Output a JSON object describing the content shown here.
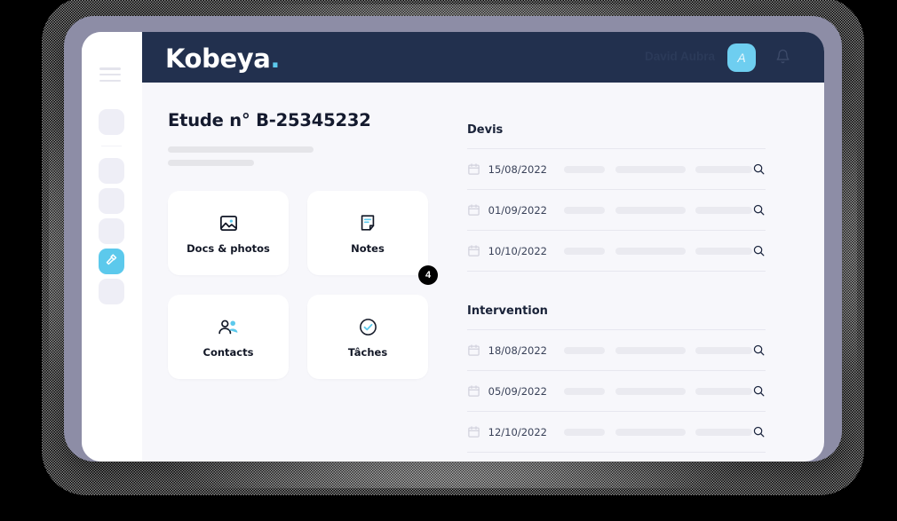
{
  "app": {
    "logo_text": "Kobeya",
    "logo_dot": ".",
    "accent_color": "#5cc9ec",
    "header_color": "#22304e",
    "page_bg": "#f7f7fb"
  },
  "topbar": {
    "menu_icon": "hamburger-icon",
    "user_name": "David Aubra",
    "avatar_initial": "A",
    "notifications_icon": "bell-icon"
  },
  "sidebar": {
    "items": [
      {
        "name": "sidebar-item-1",
        "active": false
      },
      {
        "name": "sidebar-item-2",
        "active": false
      },
      {
        "name": "sidebar-item-3",
        "active": false
      },
      {
        "name": "sidebar-item-4",
        "active": false
      },
      {
        "name": "sidebar-item-tools",
        "active": true,
        "icon": "hammer-icon"
      },
      {
        "name": "sidebar-item-6",
        "active": false
      }
    ]
  },
  "main": {
    "page_title": "Etude n° B-25345232",
    "cards": [
      {
        "label": "Docs & photos",
        "icon": "image-icon",
        "badge": null
      },
      {
        "label": "Notes",
        "icon": "note-icon",
        "badge": "4"
      },
      {
        "label": "Contacts",
        "icon": "contacts-icon",
        "badge": null
      },
      {
        "label": "Tâches",
        "icon": "check-circle-icon",
        "badge": null
      }
    ]
  },
  "panels": [
    {
      "title": "Devis",
      "rows": [
        {
          "date": "15/08/2022",
          "calendar_icon": "calendar-icon",
          "action_icon": "search-icon"
        },
        {
          "date": "01/09/2022",
          "calendar_icon": "calendar-icon",
          "action_icon": "search-icon"
        },
        {
          "date": "10/10/2022",
          "calendar_icon": "calendar-icon",
          "action_icon": "search-icon"
        }
      ]
    },
    {
      "title": "Intervention",
      "rows": [
        {
          "date": "18/08/2022",
          "calendar_icon": "calendar-icon",
          "action_icon": "search-icon"
        },
        {
          "date": "05/09/2022",
          "calendar_icon": "calendar-icon",
          "action_icon": "search-icon"
        },
        {
          "date": "12/10/2022",
          "calendar_icon": "calendar-icon",
          "action_icon": "search-icon"
        }
      ]
    }
  ]
}
